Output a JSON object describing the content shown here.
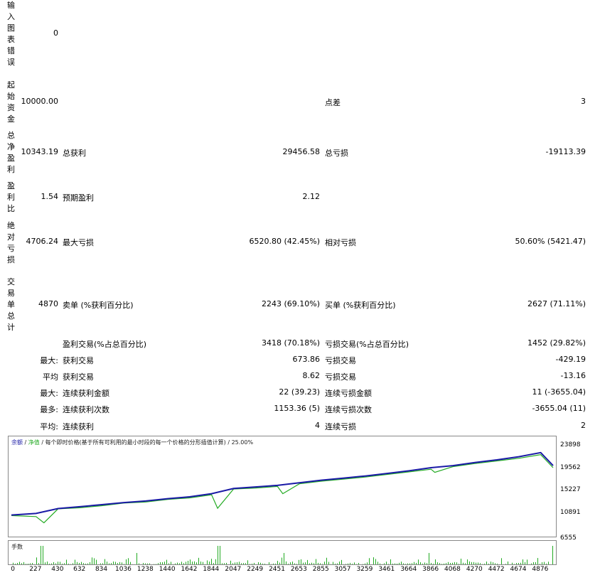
{
  "labels": {
    "input_chart_error": "输入图表错误",
    "initial_deposit": "起始资金",
    "total_net_profit": "总净盈利",
    "profit_factor": "盈利比",
    "absolute_drawdown": "绝对亏损",
    "total_trades": "交易单总计"
  },
  "values": {
    "input_chart_error": "0",
    "initial_deposit": "10000.00",
    "spread_label": "点差",
    "spread_value": "3",
    "total_net_profit": "10343.19",
    "gross_profit_label": "总获利",
    "gross_profit_value": "29456.58",
    "gross_loss_label": "总亏损",
    "gross_loss_value": "-19113.39",
    "profit_factor": "1.54",
    "expected_payoff_label": "预期盈利",
    "expected_payoff_value": "2.12",
    "absolute_drawdown": "4706.24",
    "max_drawdown_label": "最大亏损",
    "max_drawdown_value": "6520.80 (42.45%)",
    "relative_drawdown_label": "相对亏损",
    "relative_drawdown_value": "50.60% (5421.47)",
    "total_trades": "4870",
    "short_label": "卖单 (%获利百分比)",
    "short_value": "2243 (69.10%)",
    "long_label": "买单 (%获利百分比)",
    "long_value": "2627 (71.11%)"
  },
  "rows": [
    {
      "prefix": "",
      "label_a": "盈利交易(%占总百分比)",
      "value_a": "3418 (70.18%)",
      "label_b": "亏损交易(%占总百分比)",
      "value_b": "1452 (29.82%)"
    },
    {
      "prefix": "最大:",
      "label_a": "获利交易",
      "value_a": "673.86",
      "label_b": "亏损交易",
      "value_b": "-429.19"
    },
    {
      "prefix": "平均",
      "label_a": "获利交易",
      "value_a": "8.62",
      "label_b": "亏损交易",
      "value_b": "-13.16"
    },
    {
      "prefix": "最大:",
      "label_a": "连续获利金额",
      "value_a": "22 (39.23)",
      "label_b": "连续亏损金额",
      "value_b": "11 (-3655.04)"
    },
    {
      "prefix": "最多:",
      "label_a": "连续获利次数",
      "value_a": "1153.36 (5)",
      "label_b": "连续亏损次数",
      "value_b": "-3655.04 (11)"
    },
    {
      "prefix": "平均:",
      "label_a": "连续获利",
      "value_a": "4",
      "label_b": "连续亏损",
      "value_b": "2"
    }
  ],
  "chart": {
    "legend_balance": "余额",
    "legend_sep1": " / ",
    "legend_equity": "净值",
    "legend_rest": " / 每个即时价格(基于所有可利用的最小时段的每一个价格的分形插值计算) / 25.00%",
    "volume_label": "手数",
    "balance_color": "#1a1aa6",
    "equity_color": "#22aa22"
  },
  "chart_data": {
    "type": "line",
    "y_ticks": [
      "23898",
      "19562",
      "15227",
      "10891",
      "6555"
    ],
    "x_ticks": [
      "0",
      "227",
      "430",
      "632",
      "834",
      "1036",
      "1238",
      "1440",
      "1642",
      "1844",
      "2047",
      "2249",
      "2451",
      "2653",
      "2855",
      "3057",
      "3259",
      "3461",
      "3664",
      "3866",
      "4068",
      "4270",
      "4472",
      "4674",
      "4876"
    ],
    "ylim": [
      6555,
      23898
    ],
    "xlim": [
      0,
      4876
    ],
    "series": [
      {
        "name": "余额",
        "x": [
          0,
          227,
          430,
          632,
          834,
          1036,
          1238,
          1440,
          1642,
          1844,
          2047,
          2249,
          2451,
          2653,
          2855,
          3057,
          3259,
          3461,
          3664,
          3866,
          4068,
          4270,
          4472,
          4674,
          4876,
          4990
        ],
        "values": [
          10700,
          11000,
          11950,
          12300,
          12700,
          13100,
          13400,
          13850,
          14200,
          14800,
          15800,
          16100,
          16400,
          16900,
          17400,
          17800,
          18200,
          18700,
          19200,
          19800,
          20200,
          20800,
          21300,
          21900,
          22700,
          20200
        ]
      },
      {
        "name": "净值",
        "x": [
          0,
          227,
          300,
          430,
          632,
          834,
          1036,
          1238,
          1440,
          1642,
          1844,
          1900,
          2047,
          2249,
          2451,
          2500,
          2653,
          2855,
          3057,
          3259,
          3461,
          3664,
          3866,
          3900,
          4068,
          4270,
          4472,
          4674,
          4876,
          4990
        ],
        "values": [
          10600,
          10400,
          9200,
          11900,
          12100,
          12500,
          13000,
          13200,
          13700,
          14000,
          14600,
          12000,
          15700,
          15900,
          16200,
          14800,
          16700,
          17200,
          17600,
          18000,
          18500,
          19000,
          19500,
          18900,
          20000,
          20600,
          21100,
          21600,
          22300,
          19800
        ]
      }
    ]
  }
}
